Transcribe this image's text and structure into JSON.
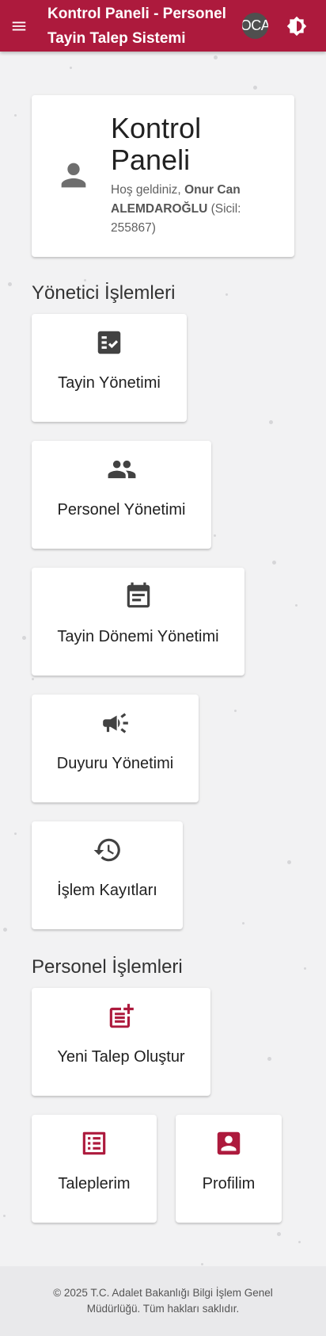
{
  "header": {
    "title": "Kontrol Paneli - Personel Tayin Talep Sistemi",
    "avatar_initials": "OCA",
    "menu_icon": "menu-icon",
    "theme_icon": "brightness-icon"
  },
  "hero": {
    "title": "Kontrol Paneli",
    "greeting": "Hoş geldiniz,",
    "user_name": "Onur Can ALEMDAROĞLU",
    "sicil": "(Sicil: 255867)",
    "icon": "person-icon"
  },
  "admin_section": {
    "title": "Yönetici İşlemleri",
    "items": [
      {
        "label": "Tayin Yönetimi",
        "icon": "checklist-icon"
      },
      {
        "label": "Personel Yönetimi",
        "icon": "people-icon"
      },
      {
        "label": "Tayin Dönemi Yönetimi",
        "icon": "calendar-icon"
      },
      {
        "label": "Duyuru Yönetimi",
        "icon": "megaphone-icon"
      },
      {
        "label": "İşlem Kayıtları",
        "icon": "history-icon"
      }
    ]
  },
  "personnel_section": {
    "title": "Personel İşlemleri",
    "items": [
      {
        "label": "Yeni Talep Oluştur",
        "icon": "post-add-icon"
      },
      {
        "label": "Taleplerim",
        "icon": "list-icon"
      },
      {
        "label": "Profilim",
        "icon": "account-box-icon"
      }
    ]
  },
  "footer": {
    "text": "© 2025 T.C. Adalet Bakanlığı Bilgi İşlem Genel Müdürlüğü. Tüm hakları saklıdır."
  },
  "colors": {
    "primary": "#ad1a3d",
    "admin_icon": "#424242",
    "background": "#f2f2f3"
  }
}
